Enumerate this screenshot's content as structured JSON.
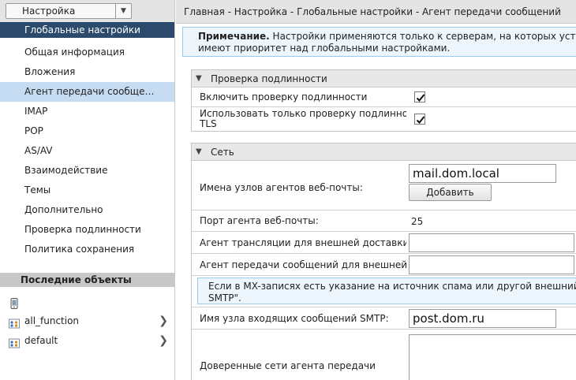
{
  "app_select": {
    "label": "Настройка"
  },
  "sidebar": {
    "section_title": "Глобальные настройки",
    "items": [
      {
        "label": "Общая информация"
      },
      {
        "label": "Вложения"
      },
      {
        "label": "Агент передачи сообще…"
      },
      {
        "label": "IMAP"
      },
      {
        "label": "POP"
      },
      {
        "label": "AS/AV"
      },
      {
        "label": "Взаимодействие"
      },
      {
        "label": "Темы"
      },
      {
        "label": "Дополнительно"
      },
      {
        "label": "Проверка подлинности"
      },
      {
        "label": "Политика сохранения"
      }
    ],
    "selected_index": 2,
    "recent_title": "Последние объекты",
    "recent_items": [
      {
        "label": "",
        "icon": "device-icon"
      },
      {
        "label": "all_function",
        "icon": "distribution-list-icon"
      },
      {
        "label": "default",
        "icon": "distribution-list-icon"
      }
    ]
  },
  "breadcrumb": "Главная - Настройка - Глобальные настройки - Агент передачи сообщений",
  "note": {
    "bold": "Примечание.",
    "line1": " Настройки применяются только к серверам, на которых установлены и",
    "line2": "имеют приоритет над глобальными настройками."
  },
  "auth_section": {
    "title": "Проверка подлинности",
    "rows": [
      {
        "label": "Включить проверку подлинности",
        "checked": true
      },
      {
        "label_line1": "Использовать только проверку подлинности",
        "label_line2": "TLS",
        "checked": true
      }
    ]
  },
  "network_section": {
    "title": "Сеть",
    "webmail_hosts_label": "Имена узлов агентов веб-почты:",
    "webmail_hosts_value": "mail.dom.local",
    "add_button": "Добавить",
    "webmail_port_label": "Порт агента веб-почты:",
    "webmail_port_value": "25",
    "relay_label": "Агент трансляции для внешней доставки:",
    "relay_value": "",
    "mta_label": "Агент передачи сообщений для внешней дост",
    "mta_value": "",
    "info_line1": "Если в MX-записях есть указание на источник спама или другой внешний не zimbr",
    "info_line2": "SMTP\".",
    "smtp_label": "Имя узла входящих сообщений SMTP:",
    "smtp_value": "post.dom.ru",
    "trusted_label": "Доверенные сети агента передачи"
  }
}
